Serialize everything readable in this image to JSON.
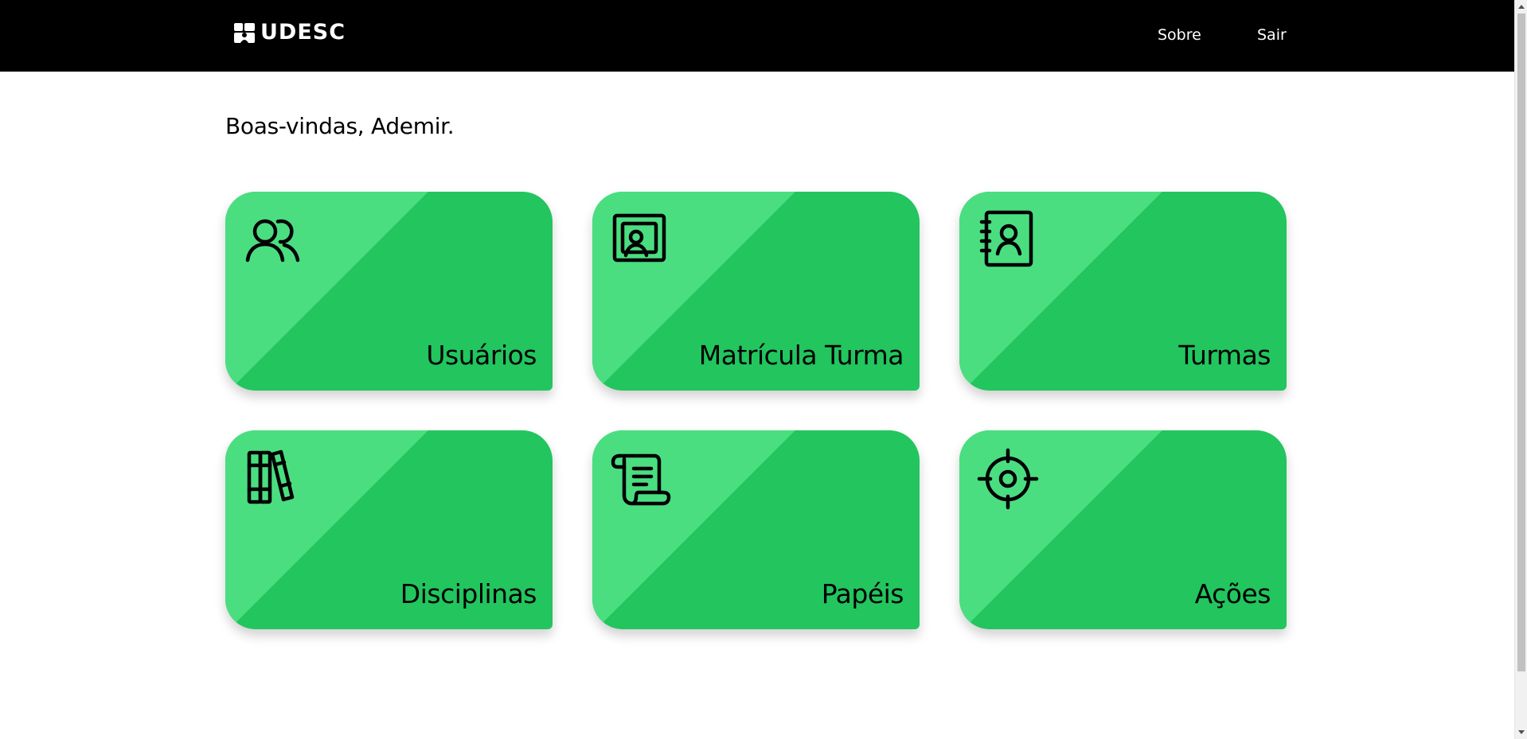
{
  "header": {
    "logo_text": "UDESC",
    "logo_icon": "udesc-logo-mark",
    "nav": [
      {
        "label": "Sobre"
      },
      {
        "label": "Sair"
      }
    ],
    "background": "#000000"
  },
  "main": {
    "welcome": "Boas-vindas, Ademir.",
    "cards": [
      {
        "label": "Usuários",
        "icon": "users-icon"
      },
      {
        "label": "Matrícula Turma",
        "icon": "enrollment-card-icon"
      },
      {
        "label": "Turmas",
        "icon": "contact-book-icon"
      },
      {
        "label": "Disciplinas",
        "icon": "books-icon"
      },
      {
        "label": "Papéis",
        "icon": "scroll-icon"
      },
      {
        "label": "Ações",
        "icon": "target-icon"
      }
    ]
  },
  "colors": {
    "card_primary": "#22c55e",
    "card_highlight": "#4ade80",
    "text": "#000000"
  }
}
